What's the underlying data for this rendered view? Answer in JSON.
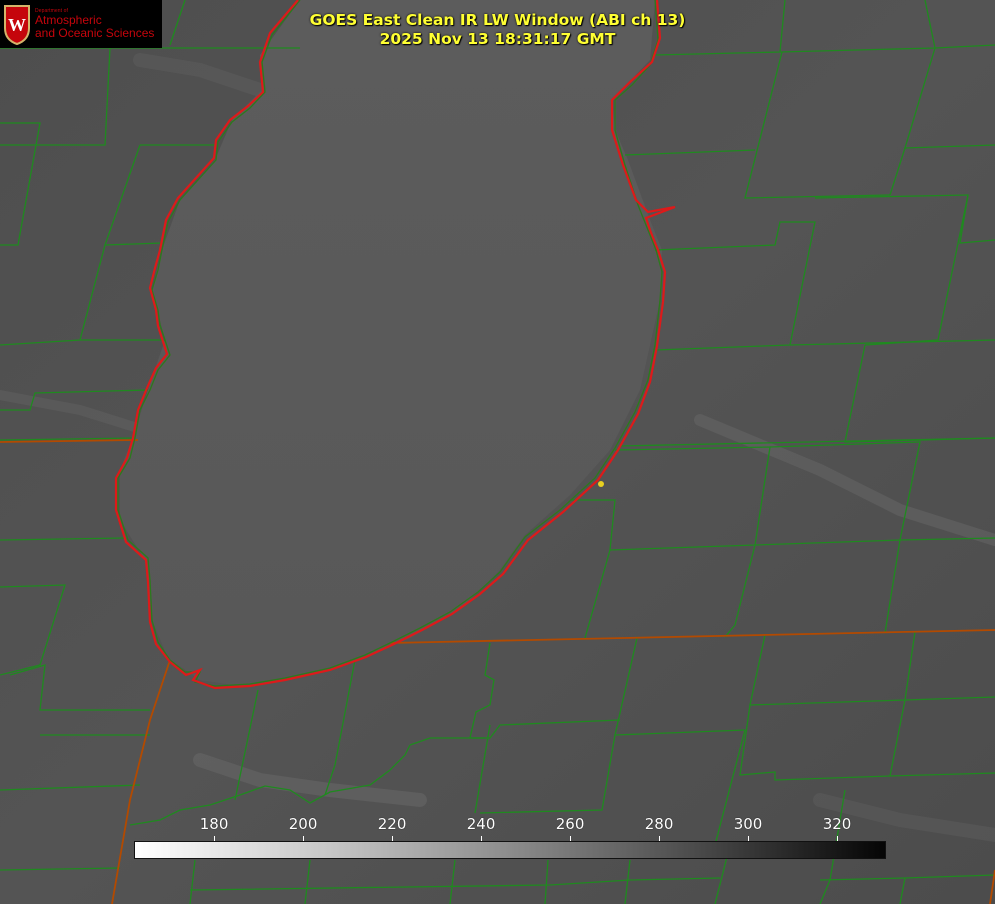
{
  "title": {
    "line1": "GOES East Clean IR LW Window (ABI ch 13)",
    "line2": "2025 Nov 13 18:31:17 GMT"
  },
  "logo": {
    "department": "Department of",
    "name_line1": "Atmospheric",
    "name_line2": "and Oceanic Sciences",
    "crest_letter": "W",
    "icon": "uw-crest-icon"
  },
  "colorbar": {
    "ticks": [
      "180",
      "200",
      "220",
      "240",
      "260",
      "280",
      "300",
      "320"
    ],
    "range": [
      162,
      331
    ],
    "colors": {
      "low": "#ffffff",
      "high": "#000000"
    }
  },
  "map_colors": {
    "lake_shore": "#dd1a1a",
    "county_lines": "#1f8a1f",
    "state_lines": "#b34a00",
    "station_marker": "#e8d020"
  }
}
